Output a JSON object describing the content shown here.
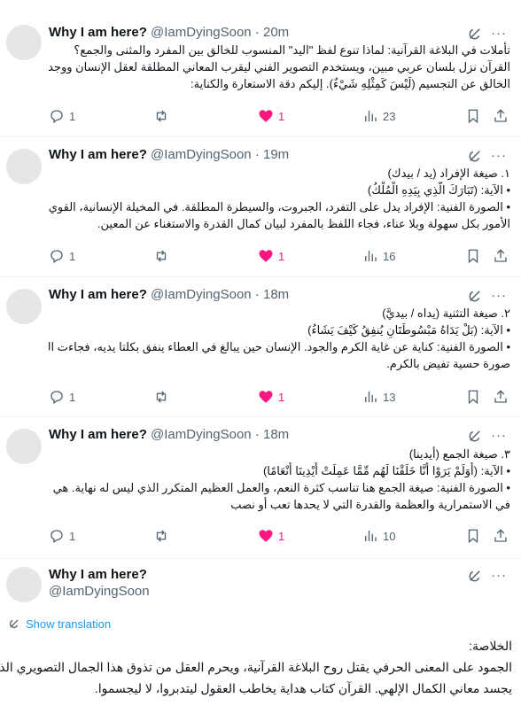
{
  "posts": [
    {
      "name": "Why I am here?",
      "handle": "@IamDyingSoon",
      "time": "20m",
      "lines": [
        "تأملات في البلاغة القرآنية: لماذا تنوع لفظ \"اليد\" المنسوب للخالق بين المفرد والمثنى والجمع؟",
        "القرآن نزل بلسان عربي مبين، ويستخدم التصوير الفني ليقرب المعاني المطلقة لعقل الإنسان ووجدانه، منزهاً",
        "الخالق عن التجسيم (لَيْسَ كَمِثْلِهِ شَيْءٌ). إليكم دقة الاستعارة والكناية:"
      ],
      "replies": "1",
      "reposts": "",
      "likes": "1",
      "views": "23"
    },
    {
      "name": "Why I am here?",
      "handle": "@IamDyingSoon",
      "time": "19m",
      "lines": [
        "١. صيغة الإفراد (يد / بيدك)",
        "• الآية: (تَبَارَكَ الَّذِي بِيَدِهِ الْمُلْكُ)",
        "• الصورة الفنية: الإفراد يدل على التفرد، الجبروت، والسيطرة المطلقة. في المخيلة الإنسانية، القوي يمسك بزمام",
        "الأمور بكل سهولة وبلا عناء، فجاء اللفظ بالمفرد لبيان كمال القدرة والاستغناء عن المعين."
      ],
      "replies": "1",
      "reposts": "",
      "likes": "1",
      "views": "16"
    },
    {
      "name": "Why I am here?",
      "handle": "@IamDyingSoon",
      "time": "18m",
      "lines": [
        "٢. صيغة التثنية (يداه / بيديَّ)",
        "• الآية: (بَلْ يَدَاهُ مَبْسُوطَتَانِ يُنفِقُ كَيْفَ يَشَاءُ)",
        "• الصورة الفنية: كناية عن غاية الكرم والجود. الإنسان حين يبالغ في العطاء ينفق بكلتا يديه، فجاءت التثنية لترسم",
        "صورة حسية تفيض بالكرم."
      ],
      "replies": "1",
      "reposts": "",
      "likes": "1",
      "views": "13"
    },
    {
      "name": "Why I am here?",
      "handle": "@IamDyingSoon",
      "time": "18m",
      "lines": [
        "٣. صيغة الجمع (أيدينا)",
        "• الآية: (أَوَلَمْ يَرَوْا أَنَّا خَلَقْنَا لَهُم مِّمَّا عَمِلَتْ أَيْدِينَا أَنْعَامًا)",
        "• الصورة الفنية: صيغة الجمع هنا تناسب كثرة النعم، والعمل العظيم المتكرر الذي ليس له نهاية. هي مبالغة بليغة",
        "في الاستمرارية والعظمة والقدرة التي لا يحدها تعب أو نصب"
      ],
      "replies": "1",
      "reposts": "",
      "likes": "1",
      "views": "10"
    }
  ],
  "last_post": {
    "name": "Why I am here?",
    "handle": "@IamDyingSoon",
    "show_translation": "Show translation",
    "conclusion_lines": [
      "الخلاصة:",
      "الجمود على المعنى الحرفي يقتل روح البلاغة القرآنية، ويحرم العقل من تذوق هذا الجمال التصويري الذي",
      "يجسد معاني الكمال الإلهي. القرآن كتاب هداية يخاطب العقول ليتدبروا، لا ليجسموا."
    ]
  },
  "colors": {
    "text": "#0f1419",
    "muted": "#536471",
    "like": "#f91880",
    "link": "#1d9bf0"
  },
  "icons": [
    "grok-icon",
    "more-icon",
    "reply-icon",
    "repost-icon",
    "like-icon",
    "views-icon",
    "bookmark-icon",
    "share-icon",
    "translate-icon"
  ]
}
